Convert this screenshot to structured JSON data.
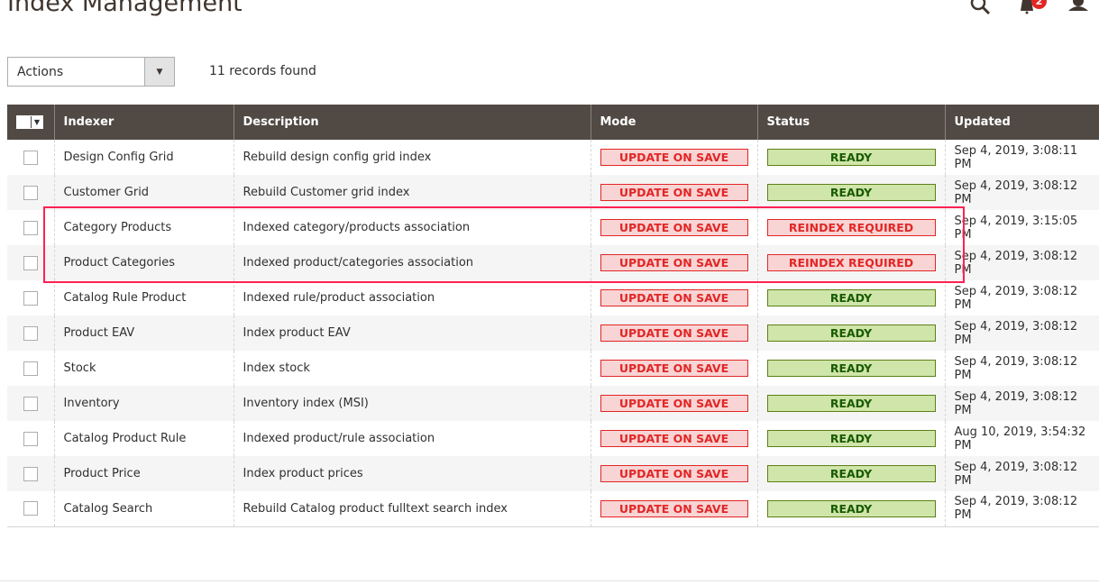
{
  "header": {
    "title": "Index Management",
    "notifications_count": "2"
  },
  "toolbar": {
    "actions_label": "Actions",
    "records": "11 records found"
  },
  "columns": [
    "Indexer",
    "Description",
    "Mode",
    "Status",
    "Updated"
  ],
  "rows": [
    {
      "indexer": "Design Config Grid",
      "description": "Rebuild design config grid index",
      "mode": "UPDATE ON SAVE",
      "status": "READY",
      "updated": "Sep 4, 2019, 3:08:11 PM"
    },
    {
      "indexer": "Customer Grid",
      "description": "Rebuild Customer grid index",
      "mode": "UPDATE ON SAVE",
      "status": "READY",
      "updated": "Sep 4, 2019, 3:08:12 PM"
    },
    {
      "indexer": "Category Products",
      "description": "Indexed category/products association",
      "mode": "UPDATE ON SAVE",
      "status": "REINDEX REQUIRED",
      "updated": "Sep 4, 2019, 3:15:05 PM"
    },
    {
      "indexer": "Product Categories",
      "description": "Indexed product/categories association",
      "mode": "UPDATE ON SAVE",
      "status": "REINDEX REQUIRED",
      "updated": "Sep 4, 2019, 3:08:12 PM"
    },
    {
      "indexer": "Catalog Rule Product",
      "description": "Indexed rule/product association",
      "mode": "UPDATE ON SAVE",
      "status": "READY",
      "updated": "Sep 4, 2019, 3:08:12 PM"
    },
    {
      "indexer": "Product EAV",
      "description": "Index product EAV",
      "mode": "UPDATE ON SAVE",
      "status": "READY",
      "updated": "Sep 4, 2019, 3:08:12 PM"
    },
    {
      "indexer": "Stock",
      "description": "Index stock",
      "mode": "UPDATE ON SAVE",
      "status": "READY",
      "updated": "Sep 4, 2019, 3:08:12 PM"
    },
    {
      "indexer": "Inventory",
      "description": "Inventory index (MSI)",
      "mode": "UPDATE ON SAVE",
      "status": "READY",
      "updated": "Sep 4, 2019, 3:08:12 PM"
    },
    {
      "indexer": "Catalog Product Rule",
      "description": "Indexed product/rule association",
      "mode": "UPDATE ON SAVE",
      "status": "READY",
      "updated": "Aug 10, 2019, 3:54:32 PM"
    },
    {
      "indexer": "Product Price",
      "description": "Index product prices",
      "mode": "UPDATE ON SAVE",
      "status": "READY",
      "updated": "Sep 4, 2019, 3:08:12 PM"
    },
    {
      "indexer": "Catalog Search",
      "description": "Rebuild Catalog product fulltext search index",
      "mode": "UPDATE ON SAVE",
      "status": "READY",
      "updated": "Sep 4, 2019, 3:08:12 PM"
    }
  ],
  "colors": {
    "header_bg": "#514943",
    "danger": "#e22626",
    "success": "#185b00",
    "highlight": "#ff2052"
  }
}
